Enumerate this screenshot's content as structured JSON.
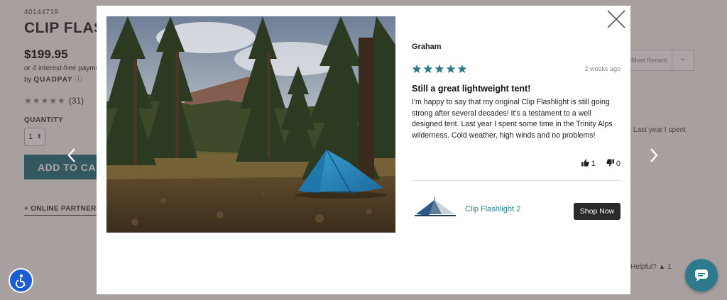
{
  "background": {
    "sku": "40144719",
    "title": "CLIP FLASHLIGHT 2",
    "price": "$199.95",
    "installment": "or 4 interest-free payments",
    "quadpay_prefix": "by",
    "quadpay_brand": "QUADPAY",
    "rating_stars": "★★★★★",
    "rating_count": "(31)",
    "quantity_label": "QUANTITY",
    "quantity_value": "1",
    "add_to_cart": "ADD TO CART",
    "online_partners": "+ ONLINE PARTNERS",
    "sort_value": "Most Recent",
    "review_snippet": "Last year I spent",
    "helpful_text": "Helpful?",
    "helpful_up": "1"
  },
  "modal": {
    "reviewer": "Graham",
    "rating": 5,
    "date": "2 weeks ago",
    "headline": "Still a great lightweight tent!",
    "body": "I'm happy to say that my original Clip Flashlight is still going strong after several decades! It's a testament to a well designed tent. Last year I spent some time in the Trinity Alps wilderness. Cold weather, high winds and no problems!",
    "votes_up": "1",
    "votes_down": "0",
    "product_name": "Clip Flashlight 2",
    "shop_button": "Shop Now"
  },
  "colors": {
    "accent": "#2d7a8c",
    "star": "#2d7a8c",
    "button_dark": "#2a2a2a",
    "a11y_blue": "#1a5bd6"
  },
  "icons": {
    "close": "close-icon",
    "prev": "chevron-left-icon",
    "next": "chevron-right-icon",
    "thumbs_up": "thumbs-up-icon",
    "thumbs_down": "thumbs-down-icon",
    "accessibility": "accessibility-icon",
    "chat": "chat-icon"
  }
}
